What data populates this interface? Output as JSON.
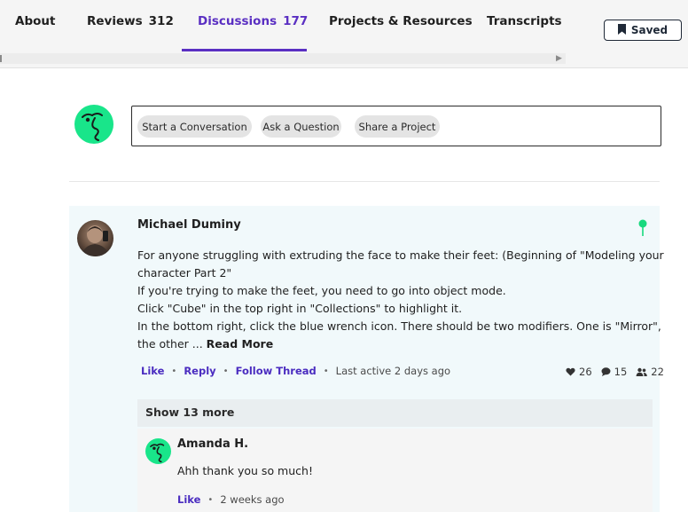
{
  "tabs": [
    {
      "label": "About",
      "count": ""
    },
    {
      "label": "Reviews",
      "count": "312"
    },
    {
      "label": "Discussions",
      "count": "177"
    },
    {
      "label": "Projects & Resources",
      "count": ""
    },
    {
      "label": "Transcripts",
      "count": ""
    }
  ],
  "active_tab": "Discussions",
  "saved_button": {
    "label": "Saved"
  },
  "composer": {
    "actions": [
      "Start a Conversation",
      "Ask a Question",
      "Share a Project"
    ]
  },
  "thread": {
    "author": "Michael Duminy",
    "body_lines": [
      "For anyone struggling with extruding the face to make their feet: (Beginning of \"Modeling your",
      "character Part 2\"",
      "If you're trying to make the feet, you need to go into object mode.",
      "Click \"Cube\" in the top right in \"Collections\" to highlight it.",
      "In the bottom right, click the blue wrench icon. There should be two modifiers. One is \"Mirror\",",
      "the other ..."
    ],
    "read_more": "Read More",
    "actions": {
      "like": "Like",
      "reply": "Reply",
      "follow": "Follow Thread",
      "last_active": "Last active 2 days ago"
    },
    "stats": {
      "likes": "26",
      "comments": "15",
      "followers": "22"
    },
    "show_more": "Show 13 more"
  },
  "reply": {
    "author": "Amanda H.",
    "body": "Ahh thank you so much!",
    "actions": {
      "like": "Like",
      "time": "2 weeks ago"
    }
  },
  "colors": {
    "accent": "#5a2fc2",
    "brand_green": "#19e58a",
    "pin": "#18d97e",
    "card_bg": "#f1f9fb"
  },
  "icons": {
    "saved": "bookmark-icon",
    "pin": "pin-icon",
    "likes": "heart-icon",
    "comments": "speech-bubble-icon",
    "followers": "people-icon",
    "logo": "face-logo-icon"
  }
}
